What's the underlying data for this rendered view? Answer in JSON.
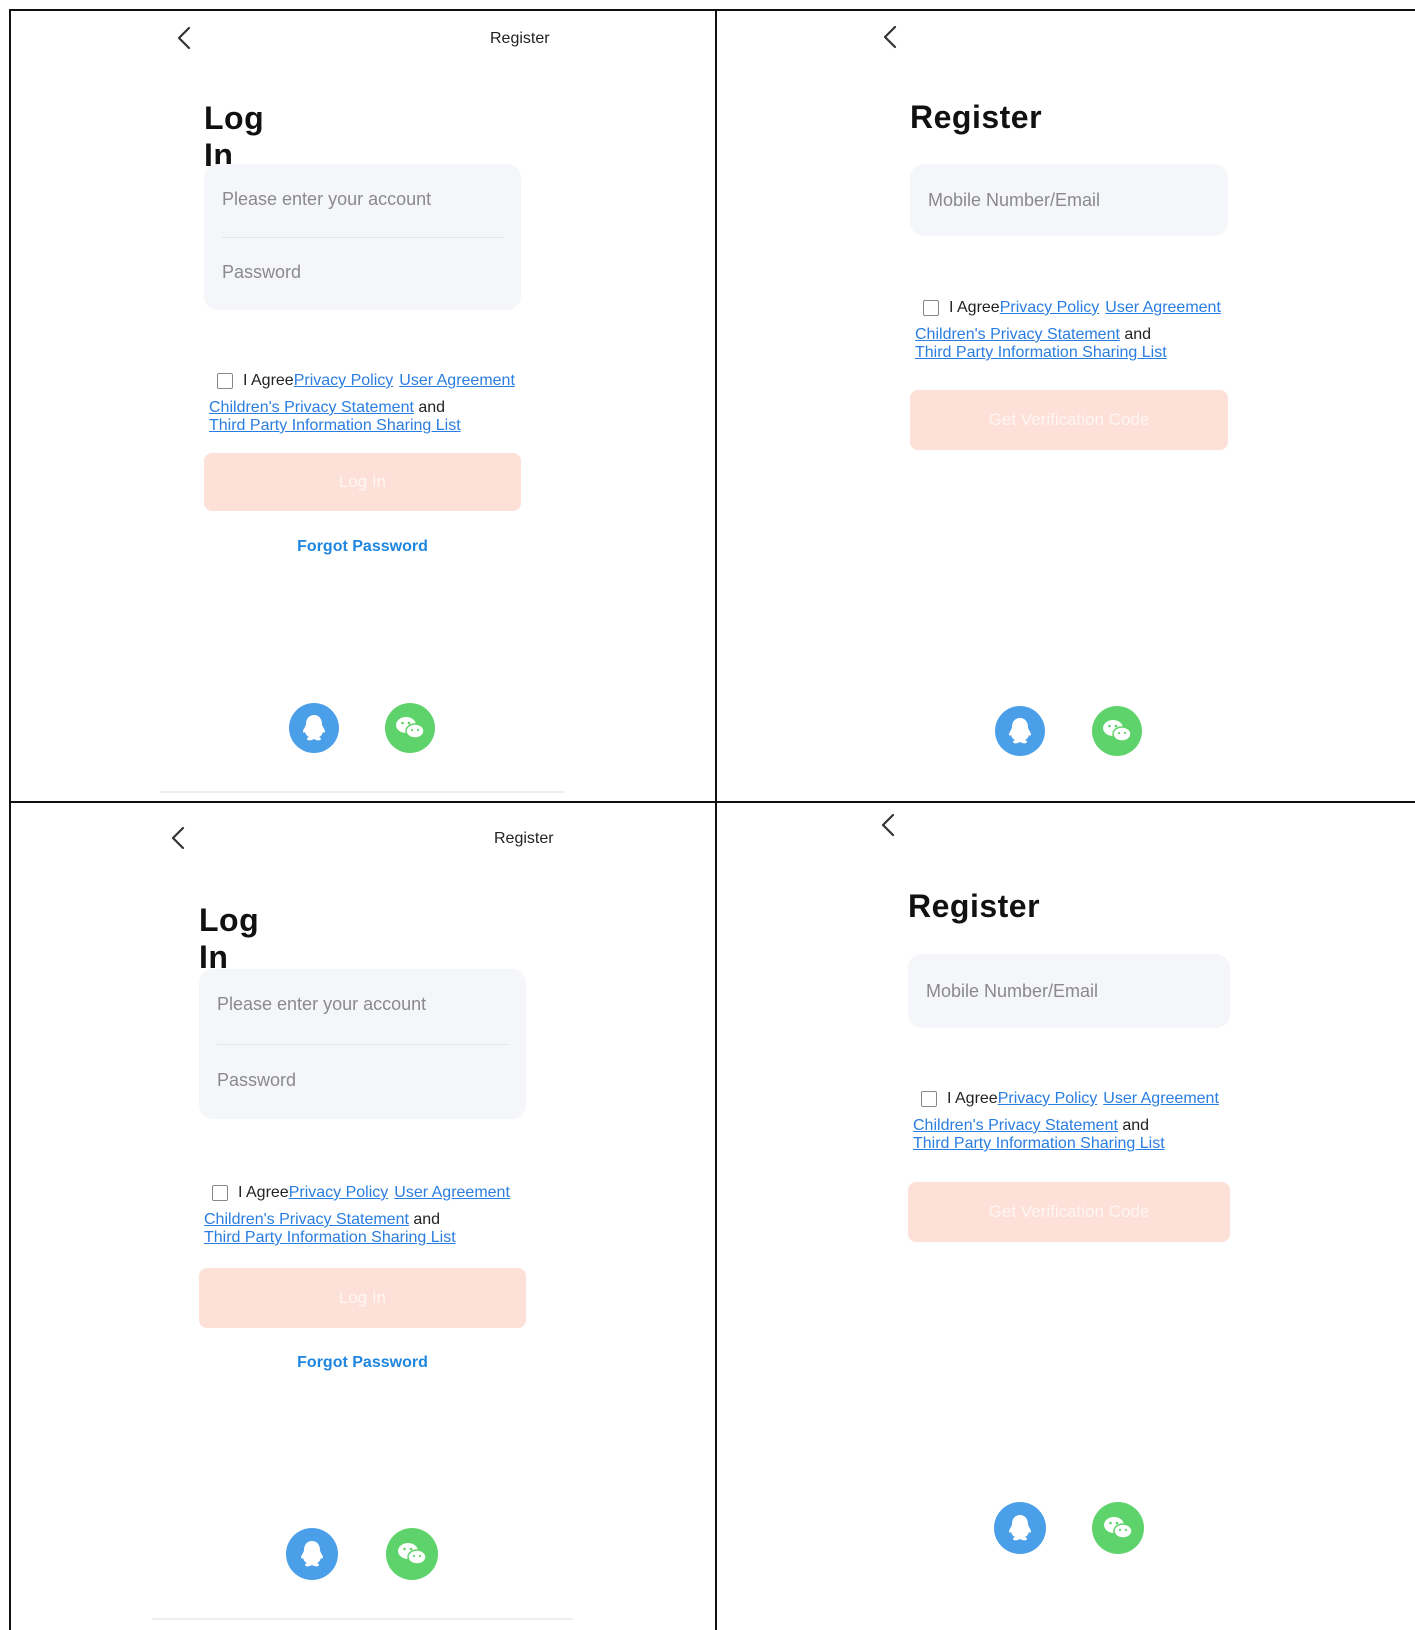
{
  "login": {
    "register_label": "Register",
    "title": "Log In",
    "account_placeholder": "Please enter your account",
    "password_placeholder": "Password",
    "agree_prefix": "I Agree",
    "privacy_policy": "Privacy Policy",
    "user_agreement": "User Agreement",
    "childrens_privacy": "Children's Privacy Statement",
    "and": "and",
    "third_party": "Third Party Information Sharing List",
    "login_button": "Log In",
    "forgot_password": "Forgot Password"
  },
  "register": {
    "title": "Register",
    "mobile_placeholder": "Mobile Number/Email",
    "agree_prefix": "I Agree",
    "privacy_policy": "Privacy Policy",
    "user_agreement": "User Agreement",
    "childrens_privacy": "Children's Privacy Statement",
    "and": "and",
    "third_party": "Third Party Information Sharing List",
    "verify_button": "Get Verification Code"
  },
  "social": {
    "qq_icon": "qq-icon",
    "wechat_icon": "wechat-icon"
  },
  "colors": {
    "link": "#2a7de1",
    "button_disabled": "#fde0d8",
    "qq": "#4b9fe9",
    "wechat": "#5fd36b"
  }
}
